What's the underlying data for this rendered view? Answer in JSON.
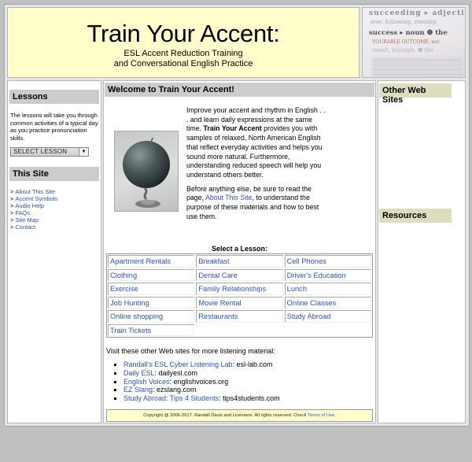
{
  "banner": {
    "title": "Train Your Accent:",
    "subtitle_line1": "ESL Accent Reduction Training",
    "subtitle_line2": "and Conversational English Practice",
    "image_words": [
      "succeeding ▸ adjective",
      "sive, following, ensuing",
      "success ▸ noun ❶ the",
      "VOURABLE OUTCOME, suc",
      "result, triumph. ❷ the"
    ]
  },
  "left": {
    "lessons_heading": "Lessons",
    "lessons_text": "The lessons will take you through common activities of a typical day as you practice pronunciation skills.",
    "select_value": "SELECT LESSON",
    "site_heading": "This Site",
    "bullet": ">",
    "site_links": [
      "About This Site",
      "Accent Symbols",
      "Audio Help",
      "FAQs",
      "Site Map",
      "Contact"
    ]
  },
  "main": {
    "heading": "Welcome to Train Your Accent!",
    "para1_a": "Improve your accent and rhythm in English . . . and learn daily expressions at the same time. ",
    "para1_bold": "Train Your Accent",
    "para1_b": " provides you with samples of relaxed, North American English that reflect everyday activities and helps you sound more natural. Furthermore, understanding reduced speech will help you understand others better.",
    "para2_a": "Before anything else, be sure to read the page, ",
    "para2_link": "About This Site",
    "para2_b": ", to understand the purpose of these materials and how to best use them.",
    "lesson_title": "Select a Lesson:",
    "lessons": [
      "Apartment Rentals",
      "Breakfast",
      "Cell Phones",
      "Clothing",
      "Dental Care",
      "Driver's Education",
      "Exercise",
      "Family Relationships",
      "Lunch",
      "Job Hunting",
      "Movie Rental",
      "Online Classes",
      "Online shopping",
      "Restaurants",
      "Study Abroad",
      "Train Tickets"
    ],
    "visit_text": "Visit these other Web sites for more listening material:",
    "other_sites": [
      {
        "name": "Randall's ESL Cyber Listening Lab",
        "domain": ": esl-lab.com"
      },
      {
        "name": "Daily ESL",
        "domain": ": dailyesl.com"
      },
      {
        "name": "English Voices",
        "domain": ": englishvoices.org"
      },
      {
        "name": "EZ Slang",
        "domain": ": ezslang.com"
      },
      {
        "name": "Study Abroad: Tips 4 Students",
        "domain": ": tips4students.com"
      }
    ],
    "footer_text": "Copyright @ 2006-2017. Randall Davis and Licensers. All rights reserved. Check ",
    "footer_link": "Terms of Use",
    "footer_end": "."
  },
  "right": {
    "other_heading": "Other Web Sites",
    "resources_heading": "Resources"
  }
}
